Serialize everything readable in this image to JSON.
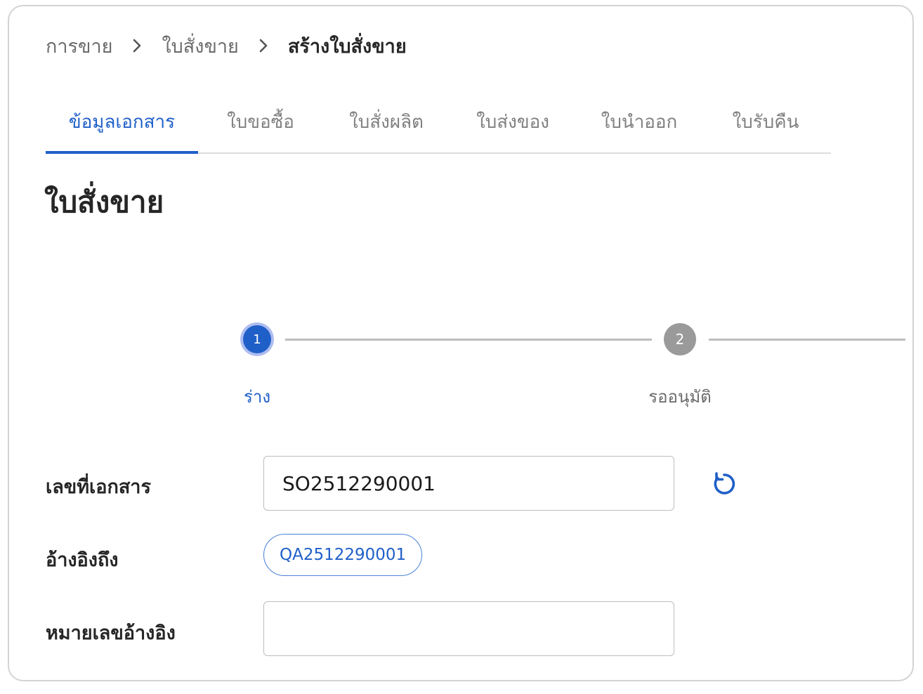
{
  "breadcrumb": {
    "items": [
      "การขาย",
      "ใบสั่งขาย",
      "สร้างใบสั่งขาย"
    ]
  },
  "tabs": [
    {
      "label": "ข้อมูลเอกสาร",
      "active": true
    },
    {
      "label": "ใบขอซื้อ",
      "active": false
    },
    {
      "label": "ใบสั่งผลิต",
      "active": false
    },
    {
      "label": "ใบส่งของ",
      "active": false
    },
    {
      "label": "ใบนำออก",
      "active": false
    },
    {
      "label": "ใบรับคืน",
      "active": false
    }
  ],
  "page": {
    "title": "ใบสั่งขาย"
  },
  "stepper": {
    "steps": [
      {
        "number": "1",
        "label": "ร่าง",
        "status": "active"
      },
      {
        "number": "2",
        "label": "รออนุมัติ",
        "status": "pending"
      }
    ]
  },
  "form": {
    "document_number": {
      "label": "เลขที่เอกสาร",
      "value": "SO2512290001"
    },
    "reference": {
      "label": "อ้างอิงถึง",
      "chip": "QA2512290001"
    },
    "reference_number": {
      "label": "หมายเลขอ้างอิง",
      "value": ""
    }
  },
  "icons": {
    "breadcrumb_separator": "chevron-right-icon",
    "refresh": "refresh-icon"
  },
  "colors": {
    "accent": "#1f5fc8",
    "text_primary": "#262626",
    "text_muted": "#808080",
    "step_pending": "#9a9a9a",
    "border": "#bdbdbd"
  }
}
